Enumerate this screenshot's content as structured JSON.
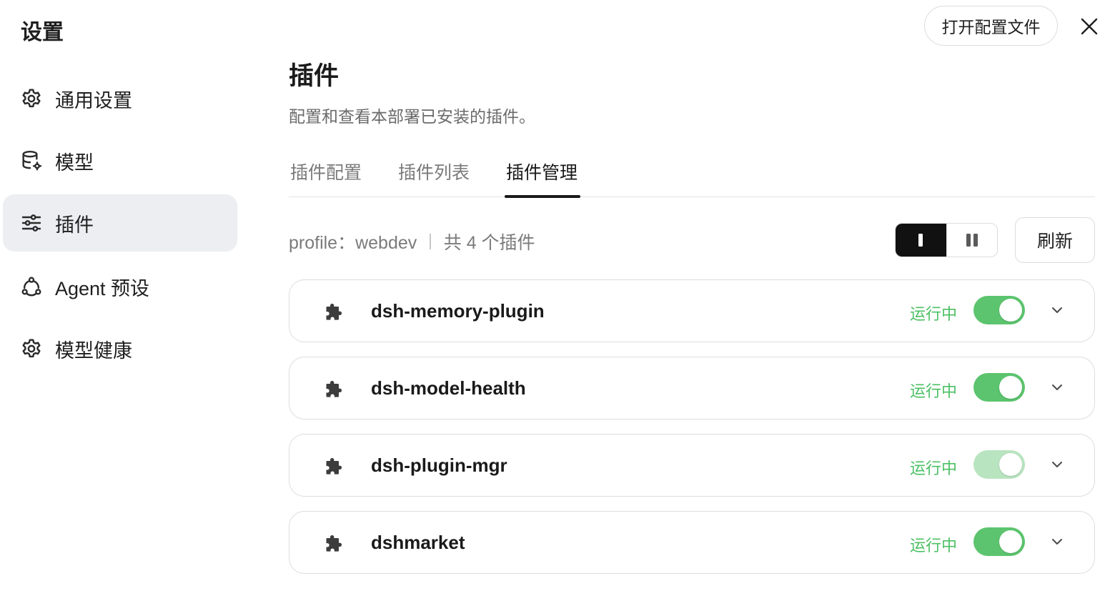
{
  "app": {
    "title": "设置"
  },
  "header": {
    "open_config_label": "打开配置文件"
  },
  "sidebar": {
    "items": [
      {
        "label": "通用设置",
        "icon": "gear-icon"
      },
      {
        "label": "模型",
        "icon": "database-icon"
      },
      {
        "label": "插件",
        "icon": "sliders-icon",
        "active": true
      },
      {
        "label": "Agent 预设",
        "icon": "agent-icon"
      },
      {
        "label": "模型健康",
        "icon": "gear-icon"
      }
    ]
  },
  "main": {
    "title": "插件",
    "description": "配置和查看本部署已安装的插件。",
    "tabs": [
      {
        "label": "插件配置"
      },
      {
        "label": "插件列表"
      },
      {
        "label": "插件管理",
        "active": true
      }
    ],
    "meta": {
      "profile": "profile：webdev",
      "count": "共 4 个插件"
    },
    "refresh_label": "刷新",
    "view_modes": [
      "single",
      "split"
    ],
    "plugins": [
      {
        "name": "dsh-memory-plugin",
        "status": "运行中",
        "enabled": true
      },
      {
        "name": "dsh-model-health",
        "status": "运行中",
        "enabled": true
      },
      {
        "name": "dsh-plugin-mgr",
        "status": "运行中",
        "enabled": true,
        "disabled_toggle": true
      },
      {
        "name": "dshmarket",
        "status": "运行中",
        "enabled": true
      }
    ]
  },
  "colors": {
    "accent_green": "#5cc46e",
    "status_text": "#4cc064",
    "active_bg": "#eceef2"
  }
}
